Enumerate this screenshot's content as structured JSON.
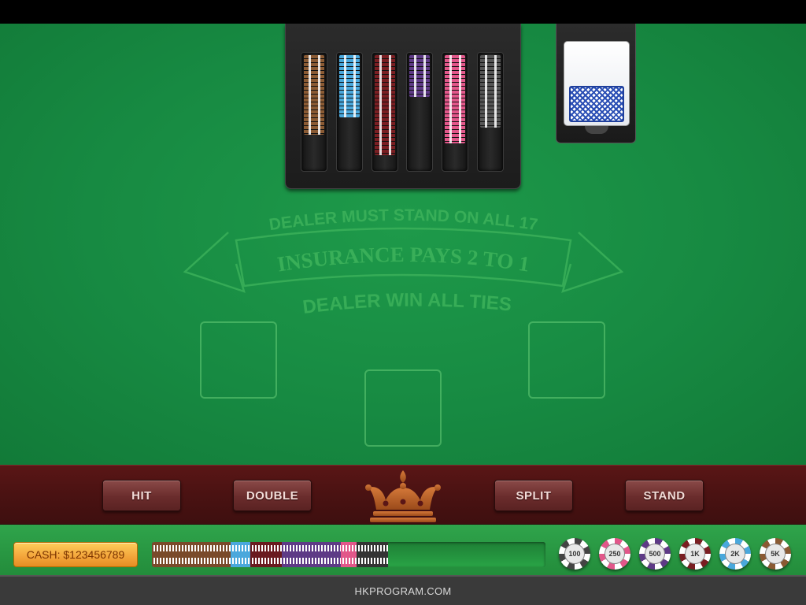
{
  "table": {
    "text_top": "DEALER MUST STAND ON ALL 17",
    "text_banner": "INSURANCE PAYS 2 TO 1",
    "text_bottom": "DEALER WIN ALL TIES"
  },
  "chip_tray": {
    "columns": [
      {
        "name": "brown",
        "color": "#8a5a33",
        "fill": 0.7
      },
      {
        "name": "light-blue",
        "color": "#4aa8dc",
        "fill": 0.55
      },
      {
        "name": "maroon",
        "color": "#7a1e22",
        "fill": 0.88
      },
      {
        "name": "purple",
        "color": "#5e3a86",
        "fill": 0.37
      },
      {
        "name": "pink",
        "color": "#e2578a",
        "fill": 0.78
      },
      {
        "name": "gray",
        "color": "#555555",
        "fill": 0.64
      }
    ]
  },
  "actions": {
    "hit": "HIT",
    "double": "DOUBLE",
    "split": "SPLIT",
    "stand": "STAND"
  },
  "cash": {
    "label": "CASH: $123456789"
  },
  "bet_bar": {
    "segments": [
      {
        "name": "brown",
        "color": "#7a4a2a",
        "fraction": 0.2
      },
      {
        "name": "light-blue",
        "color": "#4aa8dc",
        "fraction": 0.05
      },
      {
        "name": "maroon",
        "color": "#6a1a1e",
        "fraction": 0.08
      },
      {
        "name": "purple",
        "color": "#5e3a86",
        "fraction": 0.15
      },
      {
        "name": "pink",
        "color": "#e2578a",
        "fraction": 0.04
      },
      {
        "name": "dark",
        "color": "#333333",
        "fraction": 0.08
      }
    ]
  },
  "chips": [
    {
      "label": "100",
      "color": "#444444"
    },
    {
      "label": "250",
      "color": "#e2578a"
    },
    {
      "label": "500",
      "color": "#5e3a86"
    },
    {
      "label": "1K",
      "color": "#7a1e22"
    },
    {
      "label": "2K",
      "color": "#4aa8dc"
    },
    {
      "label": "5K",
      "color": "#8a5a33"
    }
  ],
  "footer": {
    "text": "HKPROGRAM.COM"
  }
}
